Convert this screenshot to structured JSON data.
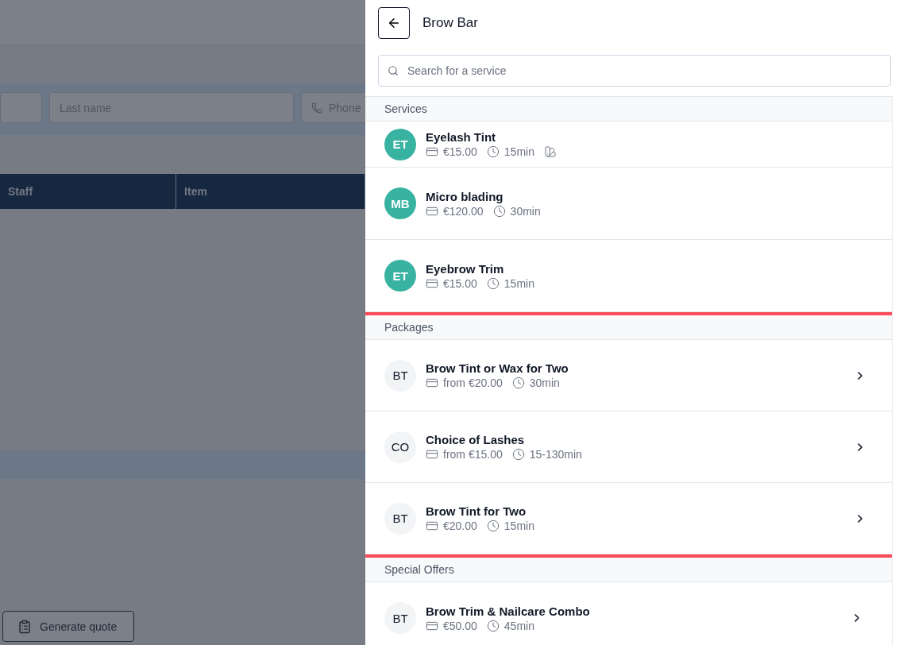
{
  "background": {
    "fields": [
      {
        "kind": "text"
      },
      {
        "kind": "text",
        "placeholder": "Last name"
      },
      {
        "kind": "phone",
        "placeholder": "Phone"
      }
    ],
    "table": {
      "columns": [
        "Staff",
        "Item"
      ]
    },
    "quote_button": "Generate quote"
  },
  "panel": {
    "title": "Brow Bar",
    "search": {
      "placeholder": "Search for a service"
    },
    "sections": [
      {
        "title": "Services",
        "highlighted": false,
        "kind": "service",
        "items": [
          {
            "initials": "ET",
            "name": "Eyelash Tint",
            "price": "€15.00",
            "duration": "15min",
            "swatch": true,
            "has_options": false
          },
          {
            "initials": "MB",
            "name": "Micro blading",
            "price": "€120.00",
            "duration": "30min",
            "swatch": false,
            "has_options": false
          },
          {
            "initials": "ET",
            "name": "Eyebrow Trim",
            "price": "€15.00",
            "duration": "15min",
            "swatch": false,
            "has_options": false
          }
        ]
      },
      {
        "title": "Packages",
        "highlighted": true,
        "kind": "package",
        "items": [
          {
            "initials": "BT",
            "name": "Brow Tint or Wax for Two",
            "price": "from €20.00",
            "duration": "30min",
            "swatch": false,
            "has_options": true
          },
          {
            "initials": "CO",
            "name": "Choice of Lashes",
            "price": "from €15.00",
            "duration": "15-130min",
            "swatch": false,
            "has_options": true
          },
          {
            "initials": "BT",
            "name": "Brow Tint for Two",
            "price": "€20.00",
            "duration": "15min",
            "swatch": false,
            "has_options": true
          }
        ]
      },
      {
        "title": "Special Offers",
        "highlighted": false,
        "kind": "package",
        "items": [
          {
            "initials": "BT",
            "name": "Brow Trim & Nailcare Combo",
            "price": "€50.00",
            "duration": "45min",
            "swatch": false,
            "has_options": true
          }
        ]
      }
    ]
  }
}
